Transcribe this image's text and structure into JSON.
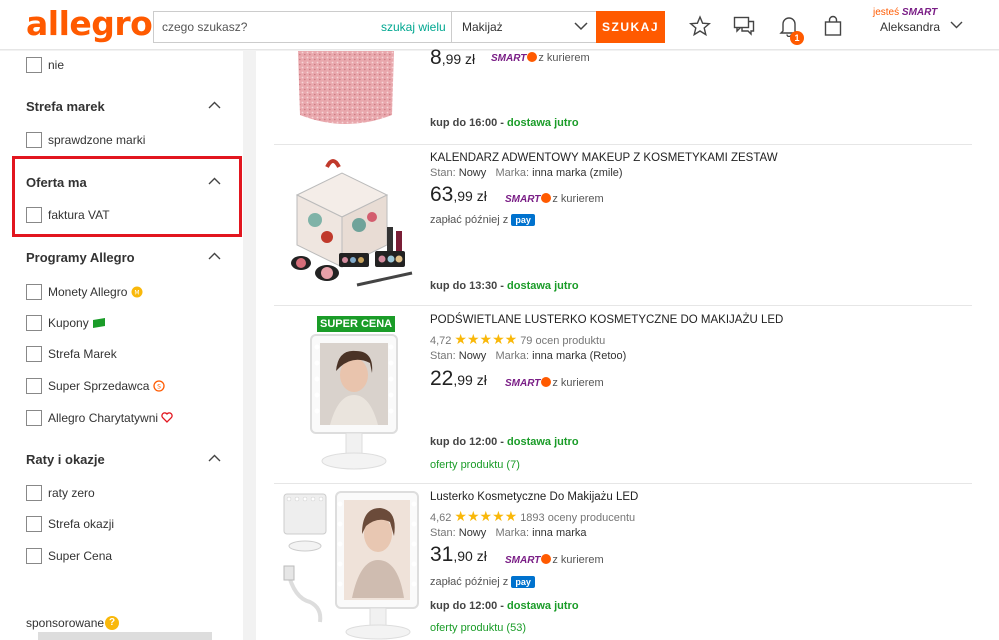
{
  "header": {
    "logo": "allegro",
    "search_placeholder": "czego szukasz?",
    "search_many": "szukaj wielu",
    "category": "Makijaż",
    "search_button": "SZUKAJ",
    "notifications_count": "1",
    "user_prefix": "jesteś",
    "user_smart": "SMART",
    "user_name": "Aleksandra"
  },
  "sidebar": {
    "top_item": "nie",
    "sections": [
      {
        "title": "Strefa marek",
        "items": [
          "sprawdzone marki"
        ]
      },
      {
        "title": "Oferta ma",
        "items": [
          "faktura VAT"
        ]
      },
      {
        "title": "Programy Allegro",
        "items": [
          "Monety Allegro",
          "Kupony",
          "Strefa Marek",
          "Super Sprzedawca",
          "Allegro Charytatywni"
        ]
      },
      {
        "title": "Raty i okazje",
        "items": [
          "raty zero",
          "Strefa okazji",
          "Super Cena"
        ]
      }
    ],
    "sponsored": "sponsorowane"
  },
  "products": [
    {
      "price_int": "8",
      "price_dec": ",99 zł",
      "smart": "SMART",
      "courier": "z kurierem",
      "delivery_time": "kup do 16:00 -",
      "delivery_when": "dostawa jutro"
    },
    {
      "title": "KALENDARZ ADWENTOWY MAKEUP Z KOSMETYKAMI ZESTAW",
      "stan_label": "Stan:",
      "stan": "Nowy",
      "marka_label": "Marka:",
      "marka": "inna marka (zmile)",
      "price_int": "63",
      "price_dec": ",99 zł",
      "smart": "SMART",
      "courier": "z kurierem",
      "pay_later": "zapłać później z",
      "pay_logo": "pay",
      "delivery_time": "kup do 13:30 -",
      "delivery_when": "dostawa jutro"
    },
    {
      "badge": "SUPER CENA",
      "title": "PODŚWIETLANE LUSTERKO KOSMETYCZNE DO MAKIJAŻU LED",
      "rating": "4,72",
      "stars": "★★★★★",
      "rating_count": "79 ocen produktu",
      "stan_label": "Stan:",
      "stan": "Nowy",
      "marka_label": "Marka:",
      "marka": "inna marka (Retoo)",
      "price_int": "22",
      "price_dec": ",99 zł",
      "smart": "SMART",
      "courier": "z kurierem",
      "delivery_time": "kup do 12:00 -",
      "delivery_when": "dostawa jutro",
      "offers": "oferty produktu (7)"
    },
    {
      "title": "Lusterko Kosmetyczne Do Makijażu LED",
      "rating": "4,62",
      "stars": "★★★★★",
      "rating_count": "1893 oceny producentu",
      "stan_label": "Stan:",
      "stan": "Nowy",
      "marka_label": "Marka:",
      "marka": "inna marka",
      "price_int": "31",
      "price_dec": ",90 zł",
      "smart": "SMART",
      "courier": "z kurierem",
      "pay_later": "zapłać później z",
      "pay_logo": "pay",
      "delivery_time": "kup do 12:00 -",
      "delivery_when": "dostawa jutro",
      "offers": "oferty produktu (53)"
    }
  ],
  "colors": {
    "brand": "#ff5a00",
    "smart": "#7a1e86",
    "green": "#1a9c28",
    "highlight": "#e2161f"
  }
}
